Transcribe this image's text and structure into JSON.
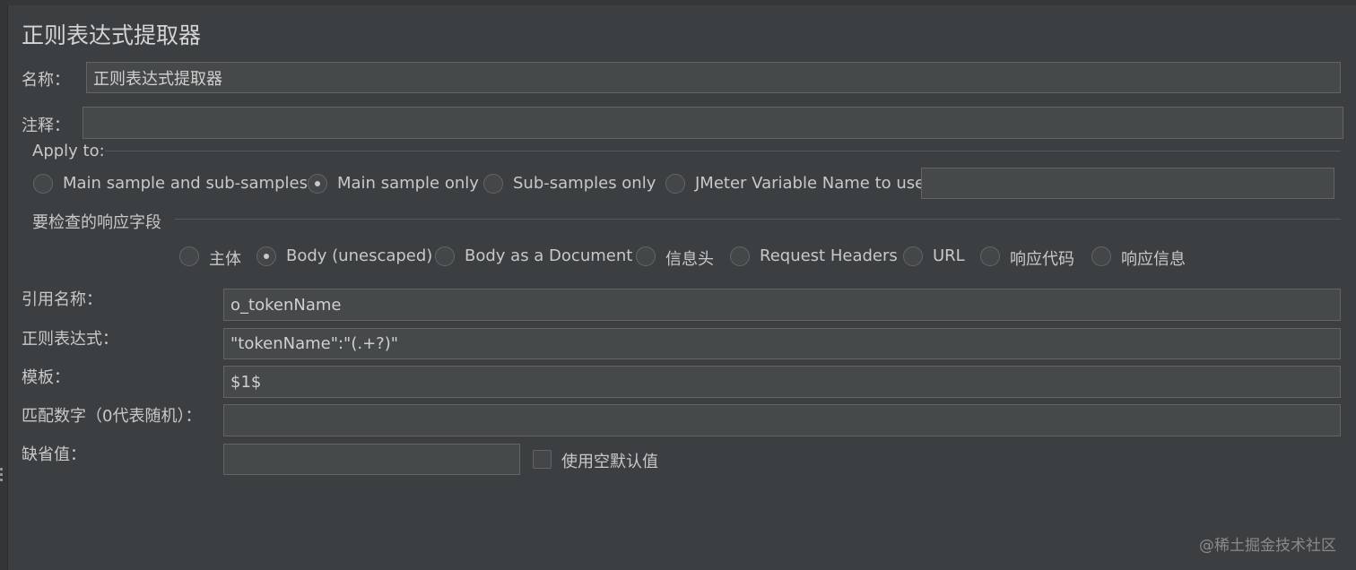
{
  "panel": {
    "title": "正则表达式提取器"
  },
  "name_row": {
    "label": "名称：",
    "value": "正则表达式提取器"
  },
  "comment_row": {
    "label": "注释：",
    "value": ""
  },
  "apply_to": {
    "label": "Apply to:",
    "options": [
      "Main sample and sub-samples",
      "Main sample only",
      "Sub-samples only",
      "JMeter Variable Name to use"
    ],
    "selected": "Main sample only",
    "variable_value": ""
  },
  "field_to_check": {
    "label": "要检查的响应字段",
    "options": [
      "主体",
      "Body (unescaped)",
      "Body as a Document",
      "信息头",
      "Request Headers",
      "URL",
      "响应代码",
      "响应信息"
    ],
    "selected": "Body (unescaped)"
  },
  "ref_name": {
    "label": "引用名称：",
    "value": "o_tokenName"
  },
  "regex": {
    "label": "正则表达式：",
    "value": "\"tokenName\":\"(.+?)\""
  },
  "template": {
    "label": "模板：",
    "value": "$1$"
  },
  "match_no": {
    "label": "匹配数字（0代表随机）：",
    "value": ""
  },
  "default_value": {
    "label": "缺省值：",
    "value": "",
    "use_empty_label": "使用空默认值",
    "use_empty_checked": false
  },
  "watermark": "@稀土掘金技术社区",
  "colors": {
    "background": "#3c3f41",
    "field_bg": "#45494a",
    "border": "#646464",
    "text": "#c8c8c8"
  }
}
